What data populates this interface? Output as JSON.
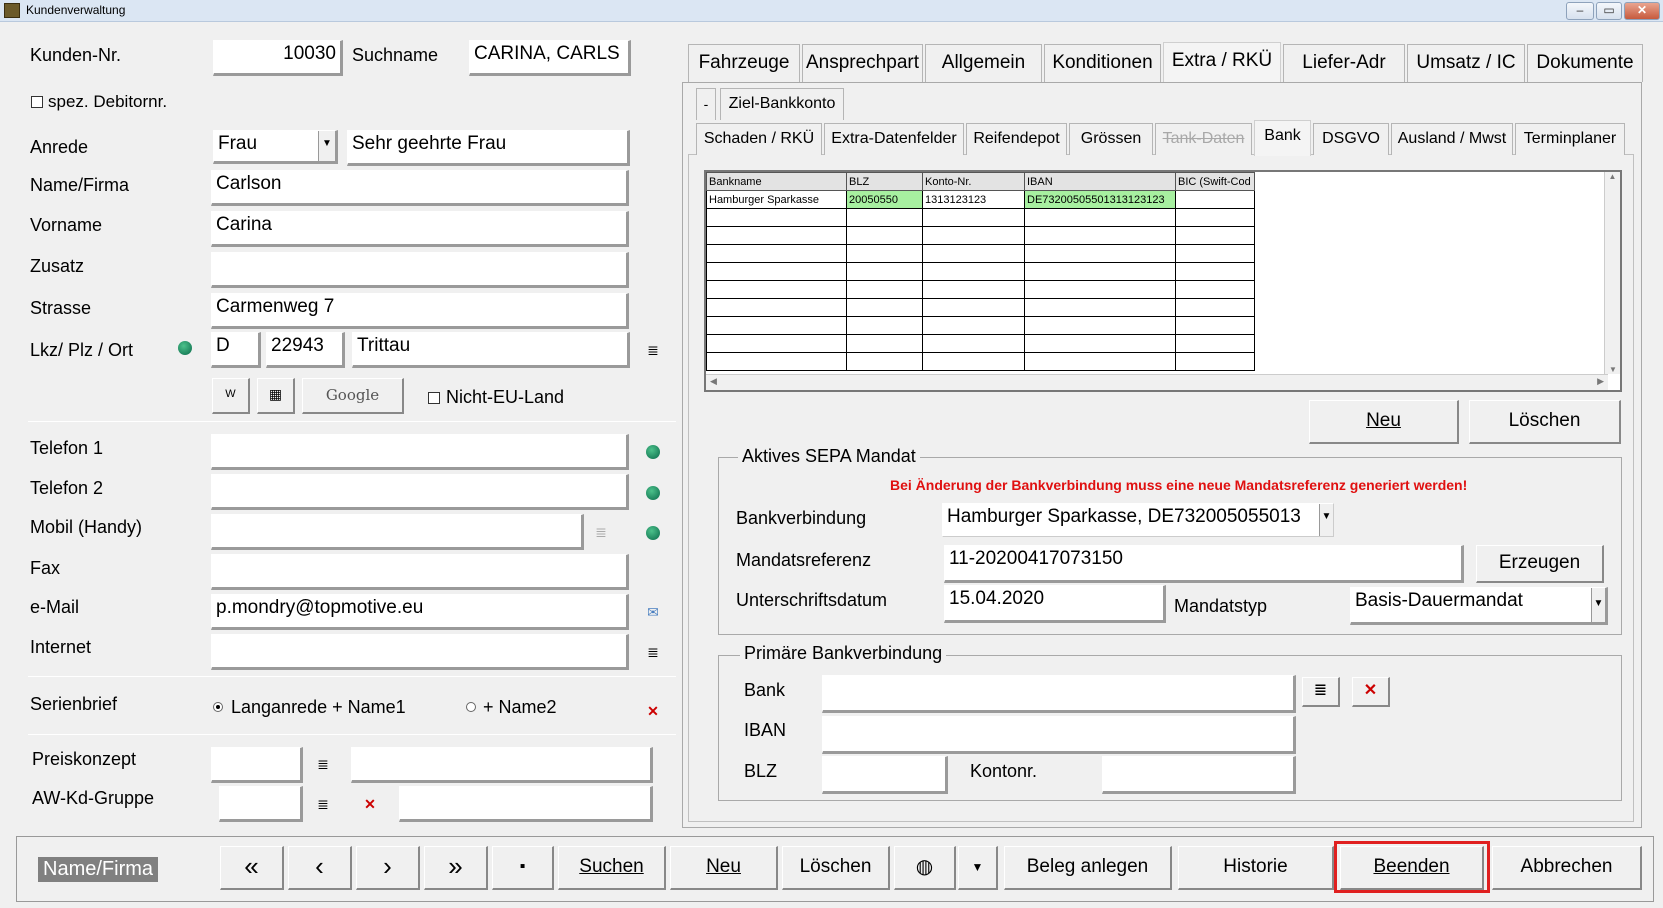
{
  "window": {
    "title": "Kundenverwaltung"
  },
  "left": {
    "kunden_nr_label": "Kunden-Nr.",
    "kunden_nr": "10030",
    "suchname_label": "Suchname",
    "suchname": "CARINA, CARLS",
    "spez_debitor_label": "spez. Debitornr.",
    "anrede_label": "Anrede",
    "anrede": "Frau",
    "briefanrede": "Sehr geehrte Frau",
    "name_label": "Name/Firma",
    "name": "Carlson",
    "vorname_label": "Vorname",
    "vorname": "Carina",
    "zusatz_label": "Zusatz",
    "zusatz": "",
    "strasse_label": "Strasse",
    "strasse": "Carmenweg 7",
    "lkz_label": "Lkz/ Plz / Ort",
    "lkz": "D",
    "plz": "22943",
    "ort": "Trittau",
    "google_label": "Google",
    "nicht_eu_label": "Nicht-EU-Land",
    "telefon1_label": "Telefon 1",
    "telefon2_label": "Telefon 2",
    "mobil_label": "Mobil (Handy)",
    "fax_label": "Fax",
    "email_label": "e-Mail",
    "email": "p.mondry@topmotive.eu",
    "internet_label": "Internet",
    "serienbrief_label": "Serienbrief",
    "serienbrief_opt1": "Langanrede + Name1",
    "serienbrief_opt2": "+ Name2",
    "preiskonzept_label": "Preiskonzept",
    "awkd_label": "AW-Kd-Gruppe"
  },
  "tabs_top": [
    "Fahrzeuge",
    "Ansprechpart",
    "Allgemein",
    "Konditionen",
    "Extra / RKÜ",
    "Liefer-Adr",
    "Umsatz / IC",
    "Dokumente"
  ],
  "subtab_ziel": "Ziel-Bankkonto",
  "subtab_dash": "-",
  "tabs_second": [
    "Schaden / RKÜ",
    "Extra-Datenfelder",
    "Reifendepot",
    "Grössen",
    "Tank-Daten",
    "Bank",
    "DSGVO",
    "Ausland / Mwst",
    "Terminplaner"
  ],
  "bank_table": {
    "columns": [
      "Bankname",
      "BLZ",
      "Konto-Nr.",
      "IBAN",
      "BIC (Swift-Cod"
    ],
    "rows": [
      [
        "Hamburger Sparkasse",
        "20050550",
        "1313123123",
        "DE73200505501313123123",
        ""
      ]
    ]
  },
  "bank_buttons": {
    "neu": "Neu",
    "loeschen": "Löschen"
  },
  "sepa": {
    "legend": "Aktives SEPA Mandat",
    "warning": "Bei Änderung der Bankverbindung muss eine neue Mandatsreferenz generiert werden!",
    "warning_color": "#e01010",
    "bankverbindung_label": "Bankverbindung",
    "bankverbindung": "Hamburger Sparkasse, DE732005055013",
    "mandatsreferenz_label": "Mandatsreferenz",
    "mandatsreferenz": "11-20200417073150",
    "erzeugen": "Erzeugen",
    "unterschrift_label": "Unterschriftsdatum",
    "unterschrift": "15.04.2020",
    "mandatstyp_label": "Mandatstyp",
    "mandatstyp": "Basis-Dauermandat"
  },
  "primaer": {
    "legend": "Primäre Bankverbindung",
    "bank_label": "Bank",
    "iban_label": "IBAN",
    "blz_label": "BLZ",
    "kontonr_label": "Kontonr."
  },
  "bottom": {
    "status": "Name/Firma",
    "first": "«",
    "prev": "‹",
    "next": "›",
    "last": "»",
    "suchen": "Suchen",
    "neu": "Neu",
    "loeschen": "Löschen",
    "beleg": "Beleg anlegen",
    "historie": "Historie",
    "beenden": "Beenden",
    "abbrechen": "Abbrechen",
    "highlight_color": "#e02020"
  }
}
